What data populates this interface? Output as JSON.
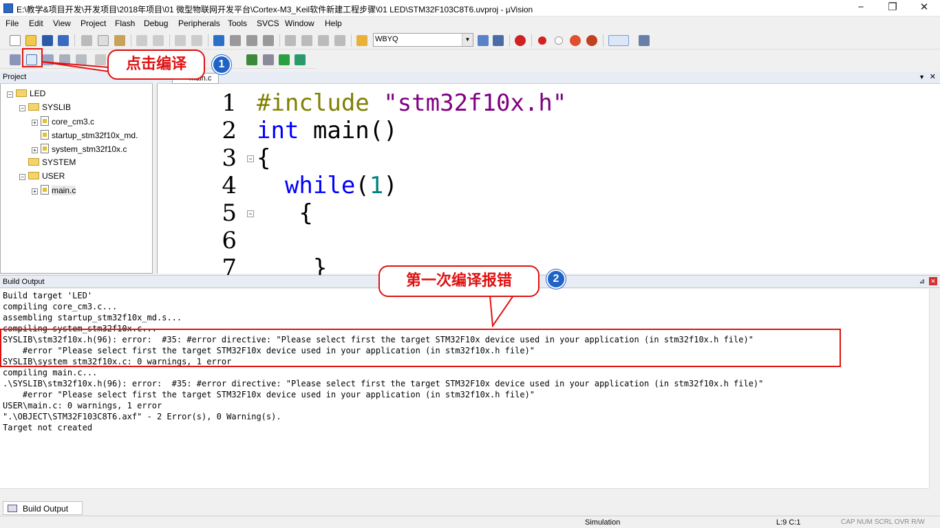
{
  "window": {
    "title": "E:\\教学&项目开发\\开发项目\\2018年项目\\01 微型物联网开发平台\\Cortex-M3_Keil软件新建工程步骤\\01 LED\\STM32F103C8T6.uvproj - µVision",
    "minimize": "−",
    "maximize": "❐",
    "close": "✕"
  },
  "menu": [
    "File",
    "Edit",
    "View",
    "Project",
    "Flash",
    "Debug",
    "Peripherals",
    "Tools",
    "SVCS",
    "Window",
    "Help"
  ],
  "toolbar": {
    "target_value": "WBYQ"
  },
  "project": {
    "header": "Project",
    "tree": [
      "LED",
      "SYSLIB",
      "core_cm3.c",
      "startup_stm32f10x_md.",
      "system_stm32f10x.c",
      "SYSTEM",
      "USER",
      "main.c"
    ]
  },
  "editor": {
    "tab": "main.c",
    "line_numbers": [
      "1",
      "2",
      "3",
      "4",
      "5",
      "6",
      "7"
    ],
    "lines": [
      [
        {
          "t": "#include ",
          "c": "#808000"
        },
        {
          "t": "\"stm32f10x.h\"",
          "c": "#800080"
        }
      ],
      [
        {
          "t": "int",
          "c": "#0000ff"
        },
        {
          "t": " main()",
          "c": "#000000"
        }
      ],
      [
        {
          "t": "{",
          "c": "#000000"
        }
      ],
      [
        {
          "t": "  while",
          "c": "#0000ff"
        },
        {
          "t": "(",
          "c": "#000000"
        },
        {
          "t": "1",
          "c": "#008080"
        },
        {
          "t": ")",
          "c": "#000000"
        }
      ],
      [
        {
          "t": "   {",
          "c": "#000000"
        }
      ],
      [
        {
          "t": "",
          "c": "#000000"
        }
      ],
      [
        {
          "t": "    }",
          "c": "#000000"
        }
      ]
    ]
  },
  "build": {
    "header": "Build Output",
    "lines": [
      "Build target 'LED'",
      "compiling core_cm3.c...",
      "assembling startup_stm32f10x_md.s...",
      "compiling system_stm32f10x.c...",
      "SYSLIB\\stm32f10x.h(96): error:  #35: #error directive: \"Please select first the target STM32F10x device used in your application (in stm32f10x.h file)\"",
      "    #error \"Please select first the target STM32F10x device used in your application (in stm32f10x.h file)\"",
      "SYSLIB\\system_stm32f10x.c: 0 warnings, 1 error",
      "compiling main.c...",
      ".\\SYSLIB\\stm32f10x.h(96): error:  #35: #error directive: \"Please select first the target STM32F10x device used in your application (in stm32f10x.h file)\"",
      "    #error \"Please select first the target STM32F10x device used in your application (in stm32f10x.h file)\"",
      "USER\\main.c: 0 warnings, 1 error",
      "\".\\OBJECT\\STM32F103C8T6.axf\" - 2 Error(s), 0 Warning(s).",
      "Target not created"
    ],
    "bottom_tab": "Build Output"
  },
  "status": {
    "mode": "Simulation",
    "position": "L:9 C:1",
    "flags": "CAP  NUM  SCRL  OVR  R/W"
  },
  "annotations": {
    "callout1": "点击编译",
    "badge1": "1",
    "callout2": "第一次编译报错",
    "badge2": "2"
  },
  "colors": {
    "accent_red": "#e01010",
    "badge_blue": "#1f63c7"
  }
}
